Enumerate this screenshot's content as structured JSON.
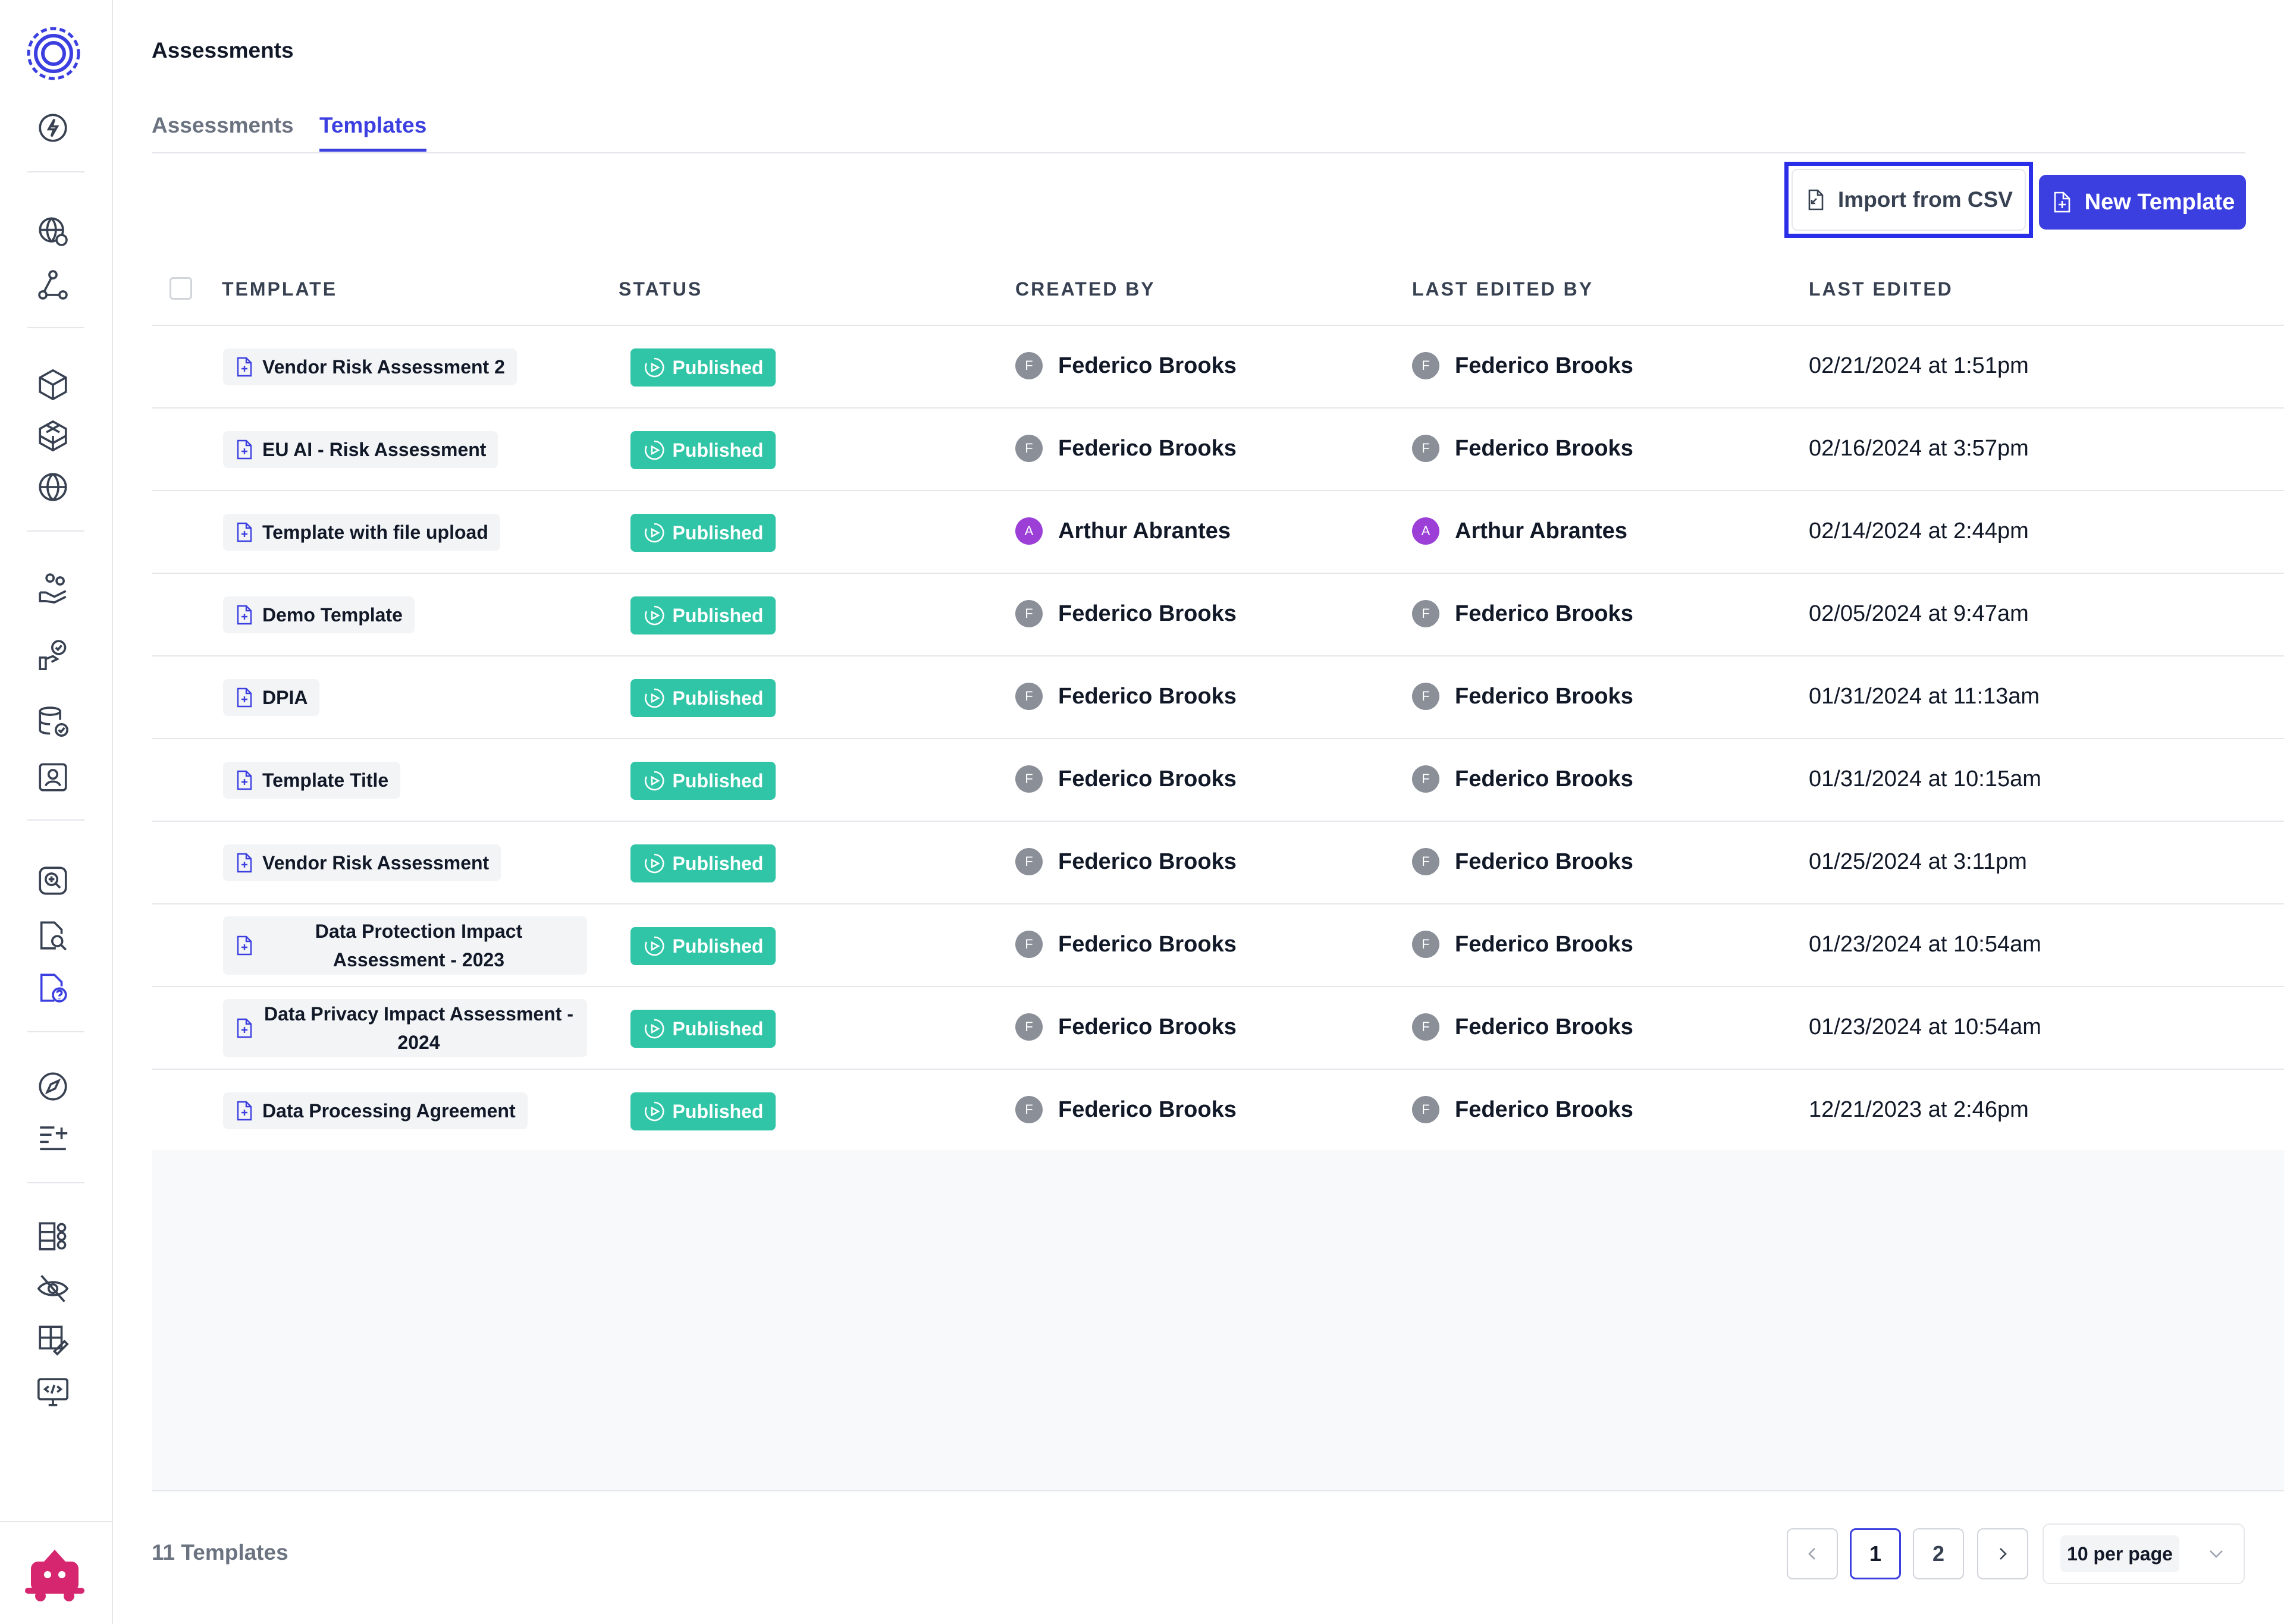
{
  "page": {
    "title": "Assessments"
  },
  "tabs": [
    {
      "label": "Assessments",
      "active": false
    },
    {
      "label": "Templates",
      "active": true
    }
  ],
  "actions": {
    "import_label": "Import from CSV",
    "new_label": "New Template"
  },
  "table": {
    "headers": [
      "TEMPLATE",
      "STATUS",
      "CREATED BY",
      "LAST EDITED BY",
      "LAST EDITED"
    ],
    "rows": [
      {
        "name": "Vendor Risk Assessment 2",
        "status": "Published",
        "created_by": "Federico Brooks",
        "created_initial": "F",
        "edited_by": "Federico Brooks",
        "edited_initial": "F",
        "last_edited": "02/21/2024 at 1:51pm"
      },
      {
        "name": "EU AI - Risk Assessment",
        "status": "Published",
        "created_by": "Federico Brooks",
        "created_initial": "F",
        "edited_by": "Federico Brooks",
        "edited_initial": "F",
        "last_edited": "02/16/2024 at 3:57pm"
      },
      {
        "name": "Template with file upload",
        "status": "Published",
        "created_by": "Arthur Abrantes",
        "created_initial": "A",
        "edited_by": "Arthur Abrantes",
        "edited_initial": "A",
        "last_edited": "02/14/2024 at 2:44pm"
      },
      {
        "name": "Demo Template",
        "status": "Published",
        "created_by": "Federico Brooks",
        "created_initial": "F",
        "edited_by": "Federico Brooks",
        "edited_initial": "F",
        "last_edited": "02/05/2024 at 9:47am"
      },
      {
        "name": "DPIA",
        "status": "Published",
        "created_by": "Federico Brooks",
        "created_initial": "F",
        "edited_by": "Federico Brooks",
        "edited_initial": "F",
        "last_edited": "01/31/2024 at 11:13am"
      },
      {
        "name": "Template Title",
        "status": "Published",
        "created_by": "Federico Brooks",
        "created_initial": "F",
        "edited_by": "Federico Brooks",
        "edited_initial": "F",
        "last_edited": "01/31/2024 at 10:15am"
      },
      {
        "name": "Vendor Risk Assessment",
        "status": "Published",
        "created_by": "Federico Brooks",
        "created_initial": "F",
        "edited_by": "Federico Brooks",
        "edited_initial": "F",
        "last_edited": "01/25/2024 at 3:11pm"
      },
      {
        "name": "Data Protection Impact Assessment - 2023",
        "status": "Published",
        "created_by": "Federico Brooks",
        "created_initial": "F",
        "edited_by": "Federico Brooks",
        "edited_initial": "F",
        "last_edited": "01/23/2024 at 10:54am"
      },
      {
        "name": "Data Privacy Impact Assessment - 2024",
        "status": "Published",
        "created_by": "Federico Brooks",
        "created_initial": "F",
        "edited_by": "Federico Brooks",
        "edited_initial": "F",
        "last_edited": "01/23/2024 at 10:54am"
      },
      {
        "name": "Data Processing Agreement",
        "status": "Published",
        "created_by": "Federico Brooks",
        "created_initial": "F",
        "edited_by": "Federico Brooks",
        "edited_initial": "F",
        "last_edited": "12/21/2023 at 2:46pm"
      }
    ]
  },
  "footer": {
    "count_label": "11 Templates",
    "pages": [
      "1",
      "2"
    ],
    "current_page": "1",
    "per_page": "10 per page"
  },
  "colors": {
    "accent": "#3b3fe0",
    "status_published": "#2fc5a6",
    "highlight_border": "#2a2ee8",
    "avatar_f": "#8a8f98",
    "avatar_a": "#9b3fd6"
  },
  "icons": {
    "sidebar": [
      "app-logo-icon",
      "bolt-icon",
      "globe-settings-icon",
      "workflow-icon",
      "box-icon",
      "cubes-icon",
      "globe-grid-icon",
      "hand-people-icon",
      "hand-thumb-icon",
      "database-check-icon",
      "contact-card-icon",
      "search-zoom-icon",
      "document-search-icon",
      "document-question-icon",
      "compass-icon",
      "list-sparkle-icon",
      "apps-grid-icon",
      "eye-off-icon",
      "grid-edit-icon",
      "code-monitor-icon",
      "mascot-icon"
    ]
  }
}
